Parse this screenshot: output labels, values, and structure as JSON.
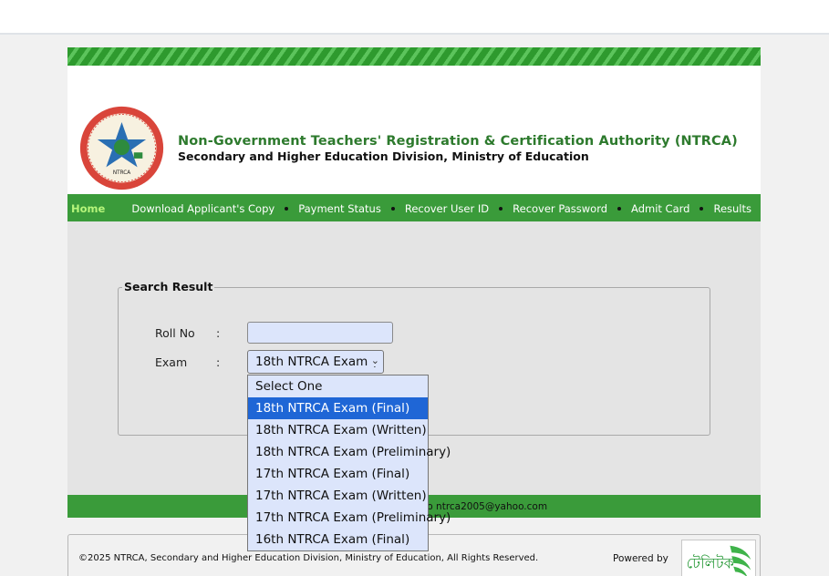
{
  "org": {
    "title": "Non-Government Teachers' Registration & Certification Authority (NTRCA)",
    "subtitle": "Secondary and Higher Education Division, Ministry of Education",
    "logo_text": "NTRCA"
  },
  "nav": {
    "home": "Home",
    "items": [
      "Download Applicant's Copy",
      "Payment Status",
      "Recover User ID",
      "Recover Password",
      "Admit Card",
      "Results"
    ]
  },
  "search": {
    "legend": "Search Result",
    "roll_label": "Roll No",
    "exam_label": "Exam",
    "colon": ":",
    "roll_value": "",
    "exam_selected": "18th NTRCA Exam ("
  },
  "dropdown": {
    "options": [
      "Select One",
      "18th NTRCA Exam (Final)",
      "18th NTRCA Exam (Written)",
      "18th NTRCA Exam (Preliminary)",
      "17th NTRCA Exam (Final)",
      "17th NTRCA Exam (Written)",
      "17th NTRCA Exam (Preliminary)",
      "16th NTRCA Exam (Final)"
    ],
    "highlighted_index": 1
  },
  "footer": {
    "contact": "il to ntrca2005@yahoo.com",
    "copyright": "©2025 NTRCA, Secondary and Higher Education Division, Ministry of Education, All Rights Reserved.",
    "powered_by": "Powered by",
    "partner_logo": "টেলিটক"
  },
  "colors": {
    "brand_green": "#3a9b3a",
    "title_green": "#2d7a2d",
    "highlight": "#1f66d6",
    "field_bg": "#dce5fb"
  }
}
